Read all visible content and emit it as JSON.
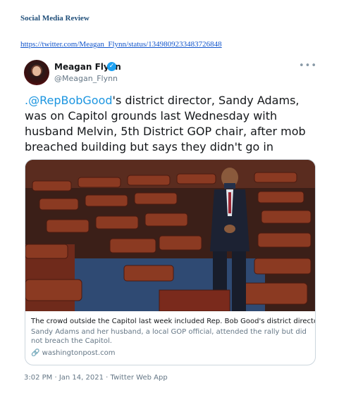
{
  "page": {
    "header": "Social Media Review",
    "link": "https://twitter.com/Meagan_Flynn/status/1349809233483726848"
  },
  "tweet": {
    "author_name": "Meagan Flynn",
    "author_handle": "@Meagan_Flynn",
    "verified_icon": "check-icon",
    "more_icon": "ellipsis-icon",
    "text_mention": ".@RepBobGood",
    "text_body": "'s district director, Sandy Adams, was on Capitol grounds last Wednesday with husband Melvin, 5th District GOP chair, after mob breached building but says they didn't go in",
    "card": {
      "caption": "The crowd outside the Capitol last week included Rep. Bob Good's district director",
      "description": "Sandy Adams and her husband, a local GOP official, attended the rally but did not breach the Capitol.",
      "domain": "washingtonpost.com",
      "link_icon": "link-icon"
    },
    "timestamp": "3:02 PM · Jan 14, 2021 · Twitter Web App"
  },
  "colors": {
    "link_blue": "#1b95e0",
    "verified_blue": "#1da1f2",
    "seat_red": "#7a2a1c",
    "carpet_blue": "#2f4a73"
  }
}
